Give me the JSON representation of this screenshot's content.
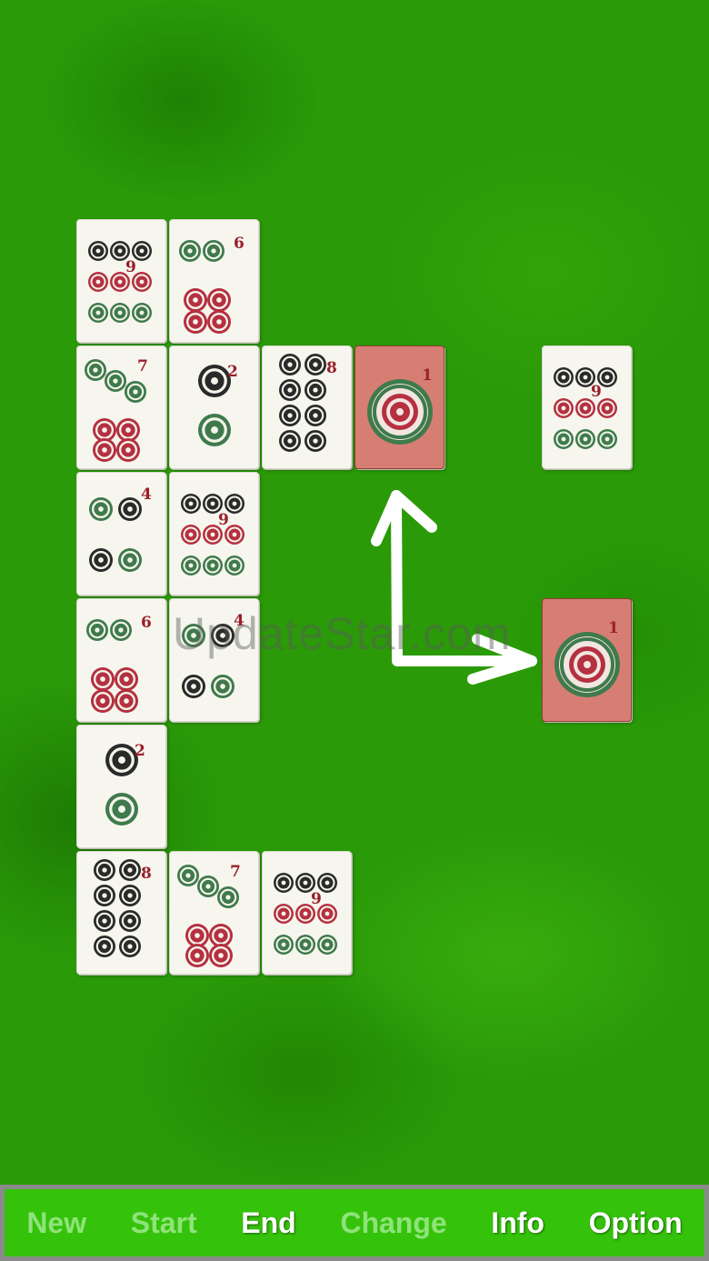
{
  "colors": {
    "felt": "#2a9a08",
    "toolbar": "#35c20b",
    "selected_tile": "#d77e74",
    "dot_black": "#2a2a2a",
    "dot_red": "#b53040",
    "dot_green": "#3f7a4c",
    "number": "#9a1f2a"
  },
  "tiles": [
    {
      "id": "t1",
      "suit": "dots",
      "rank": "9",
      "selected": false
    },
    {
      "id": "t2",
      "suit": "dots",
      "rank": "6",
      "selected": false
    },
    {
      "id": "t3",
      "suit": "dots",
      "rank": "7",
      "selected": false
    },
    {
      "id": "t4",
      "suit": "dots",
      "rank": "2",
      "selected": false
    },
    {
      "id": "t5",
      "suit": "dots",
      "rank": "8",
      "selected": false
    },
    {
      "id": "t6",
      "suit": "dots",
      "rank": "1",
      "selected": true
    },
    {
      "id": "t7",
      "suit": "dots",
      "rank": "9",
      "selected": false
    },
    {
      "id": "t8",
      "suit": "dots",
      "rank": "4",
      "selected": false
    },
    {
      "id": "t9",
      "suit": "dots",
      "rank": "9",
      "selected": false
    },
    {
      "id": "t10",
      "suit": "dots",
      "rank": "6",
      "selected": false
    },
    {
      "id": "t11",
      "suit": "dots",
      "rank": "4",
      "selected": false
    },
    {
      "id": "t12",
      "suit": "dots",
      "rank": "1",
      "selected": true
    },
    {
      "id": "t13",
      "suit": "dots",
      "rank": "2",
      "selected": false
    },
    {
      "id": "t14",
      "suit": "dots",
      "rank": "8",
      "selected": false
    },
    {
      "id": "t15",
      "suit": "dots",
      "rank": "7",
      "selected": false
    },
    {
      "id": "t16",
      "suit": "dots",
      "rank": "9",
      "selected": false
    }
  ],
  "watermark": "UpdateStar.com",
  "toolbar": {
    "new": "New",
    "start": "Start",
    "end": "End",
    "change": "Change",
    "info": "Info",
    "option": "Option"
  }
}
